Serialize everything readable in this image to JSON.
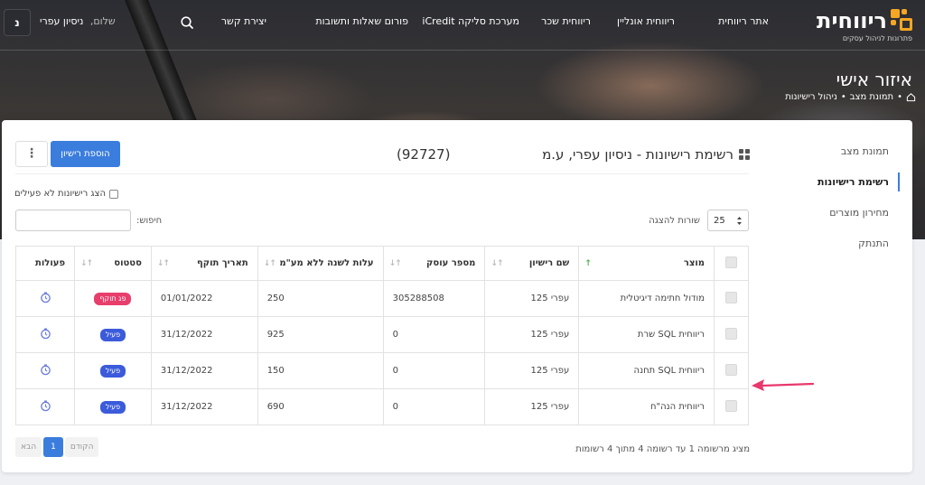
{
  "header": {
    "logo_text": "ריווחית",
    "logo_tagline": "פתרונות לניהול עסקים",
    "nav": [
      "אתר ריווחית",
      "ריווחית אונליין",
      "ריווחית שכר",
      "מערכת סליקה iCredit",
      "פורום שאלות ותשובות",
      "יצירת קשר"
    ],
    "greeting": "שלום,",
    "user_name": "ניסיון עפרי",
    "avatar_letter": "נ"
  },
  "page": {
    "title": "איזור אישי",
    "breadcrumb": [
      "תמונת מצב",
      "ניהול רישיונות"
    ]
  },
  "sidebar": {
    "items": [
      "תמונת מצב",
      "רשימת רישיונות",
      "מחירון מוצרים",
      "התנתק"
    ],
    "active_index": 1
  },
  "main": {
    "title": "רשימת רישיונות - ניסיון עפרי, ע.מ",
    "count": "(92727)",
    "add_button": "הוספת רישיון",
    "kebab": "⋮",
    "show_inactive_label": "הצג רישיונות לא פעילים",
    "rows_label": "שורות להצגה",
    "rows_value": "25",
    "search_label": "חיפוש:",
    "search_value": "",
    "columns": [
      "מוצר",
      "שם רישיון",
      "מספר עוסק",
      "עלות לשנה ללא מע\"מ",
      "תאריך תוקף",
      "סטטוס",
      "פעולות"
    ],
    "rows": [
      {
        "product": "מודול חתימה דיגיטלית",
        "license": "עפרי 125",
        "business_no": "305288508",
        "cost": "250",
        "expiry": "01/01/2022",
        "status": "פג תוקף",
        "status_color": "#e83e6c"
      },
      {
        "product": "ריווחית SQL שרת",
        "license": "עפרי 125",
        "business_no": "0",
        "cost": "925",
        "expiry": "31/12/2022",
        "status": "פעיל",
        "status_color": "#3b5bdb"
      },
      {
        "product": "ריווחית SQL תחנה",
        "license": "עפרי 125",
        "business_no": "0",
        "cost": "150",
        "expiry": "31/12/2022",
        "status": "פעיל",
        "status_color": "#3b5bdb"
      },
      {
        "product": "ריווחית הנה\"ח",
        "license": "עפרי 125",
        "business_no": "0",
        "cost": "690",
        "expiry": "31/12/2022",
        "status": "פעיל",
        "status_color": "#3b5bdb"
      }
    ],
    "table_info": "מציג מרשומה 1 עד רשומה 4 מתוך 4 רשומות",
    "pagination": {
      "prev": "הקודם",
      "current": "1",
      "next": "הבא"
    }
  },
  "colors": {
    "accent": "#3b7ddd",
    "expired": "#e83e6c",
    "active": "#3b5bdb",
    "arrow": "#e8386d",
    "logo": "#f5a623"
  },
  "icons": [
    "search-icon",
    "home-icon",
    "grid-icon",
    "sort-icon",
    "chevron-updown-icon",
    "clock-icon",
    "arrow-icon"
  ]
}
